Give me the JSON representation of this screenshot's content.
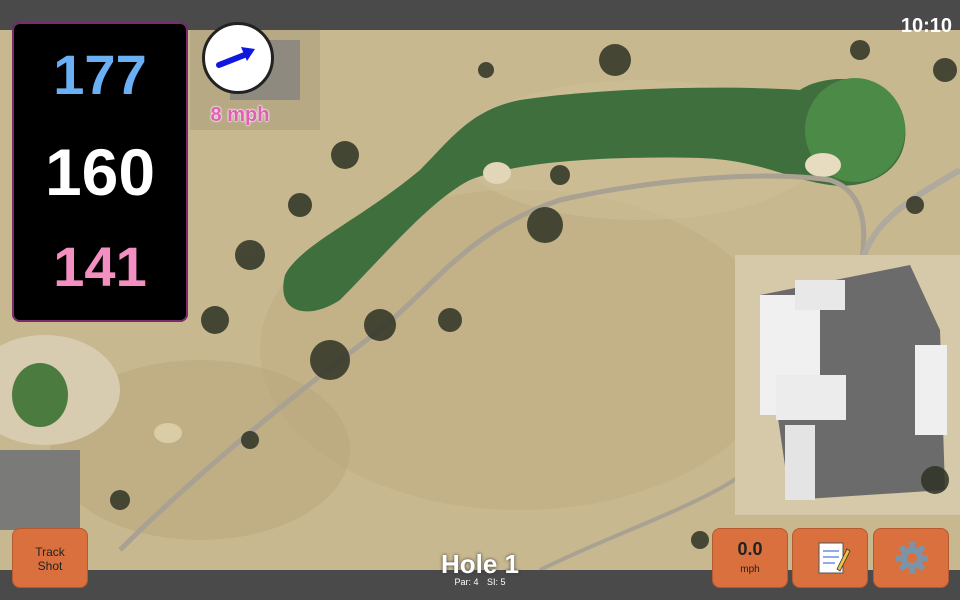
{
  "status": {
    "clock": "10:10"
  },
  "distances": {
    "back": "177",
    "middle": "160",
    "front": "141"
  },
  "wind": {
    "speed_label": "8 mph",
    "icon": "arrow-icon"
  },
  "buttons": {
    "track_shot_line1": "Track",
    "track_shot_line2": "Shot",
    "wind_value": "0.0",
    "wind_unit": "mph",
    "notes_icon": "notepad-icon",
    "settings_icon": "gear-icon"
  },
  "hole": {
    "title": "Hole 1",
    "par": "Par: 4",
    "si": "SI: 5"
  },
  "colors": {
    "back": "#6ab0f5",
    "middle": "#ffffff",
    "front": "#f48fc1",
    "button": "#d9703d",
    "wind_text": "#e05fb5"
  }
}
